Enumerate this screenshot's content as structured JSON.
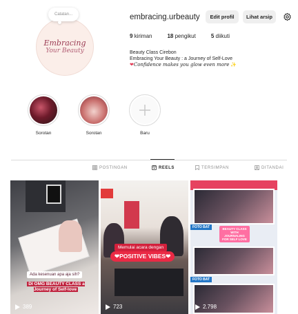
{
  "profile": {
    "avatar_line1": "Embracing",
    "avatar_line2": "Your Beauty",
    "note_text": "Catatan...",
    "username": "embracing.urbeauty",
    "edit_label": "Edit profil",
    "archive_label": "Lihat arsip",
    "stats": {
      "posts_count": "9",
      "posts_label": "kiriman",
      "followers_count": "18",
      "followers_label": "pengikut",
      "following_count": "5",
      "following_label": "diikuti"
    },
    "bio": {
      "line1": "Beauty Class Cirebon",
      "line2": "Embracing Your Beauty : a Journey of Self-Love",
      "line3": "Confidence makes you glow even more"
    }
  },
  "highlights": [
    {
      "label": "Sorotan"
    },
    {
      "label": "Sorotan"
    },
    {
      "label": "Baru"
    }
  ],
  "tabs": [
    {
      "label": "POSTINGAN",
      "icon": "grid-icon"
    },
    {
      "label": "REELS",
      "icon": "reels-icon",
      "active": true
    },
    {
      "label": "TERSIMPAN",
      "icon": "bookmark-icon"
    },
    {
      "label": "DITANDAI",
      "icon": "tagged-icon"
    }
  ],
  "reels": [
    {
      "views": "389",
      "caption1": "Ada kesenuan apa aja sih?",
      "caption2": "DI OMG BEAUTY CLASS a Journey of Self-love"
    },
    {
      "views": "723",
      "caption1": "Memulai acara dengan",
      "caption2": "POSITIVE VIBES"
    },
    {
      "views": "2.798",
      "card_text": "BEAUTY CLASS WITH JOURNALING FOR SELF LOVE",
      "label1": "FOTO BAT",
      "label2": "FOTO BAT"
    }
  ],
  "colors": {
    "accent_red": "#ea2a45",
    "text": "#262626",
    "muted": "#8e8e8e",
    "button_bg": "#efefef"
  }
}
